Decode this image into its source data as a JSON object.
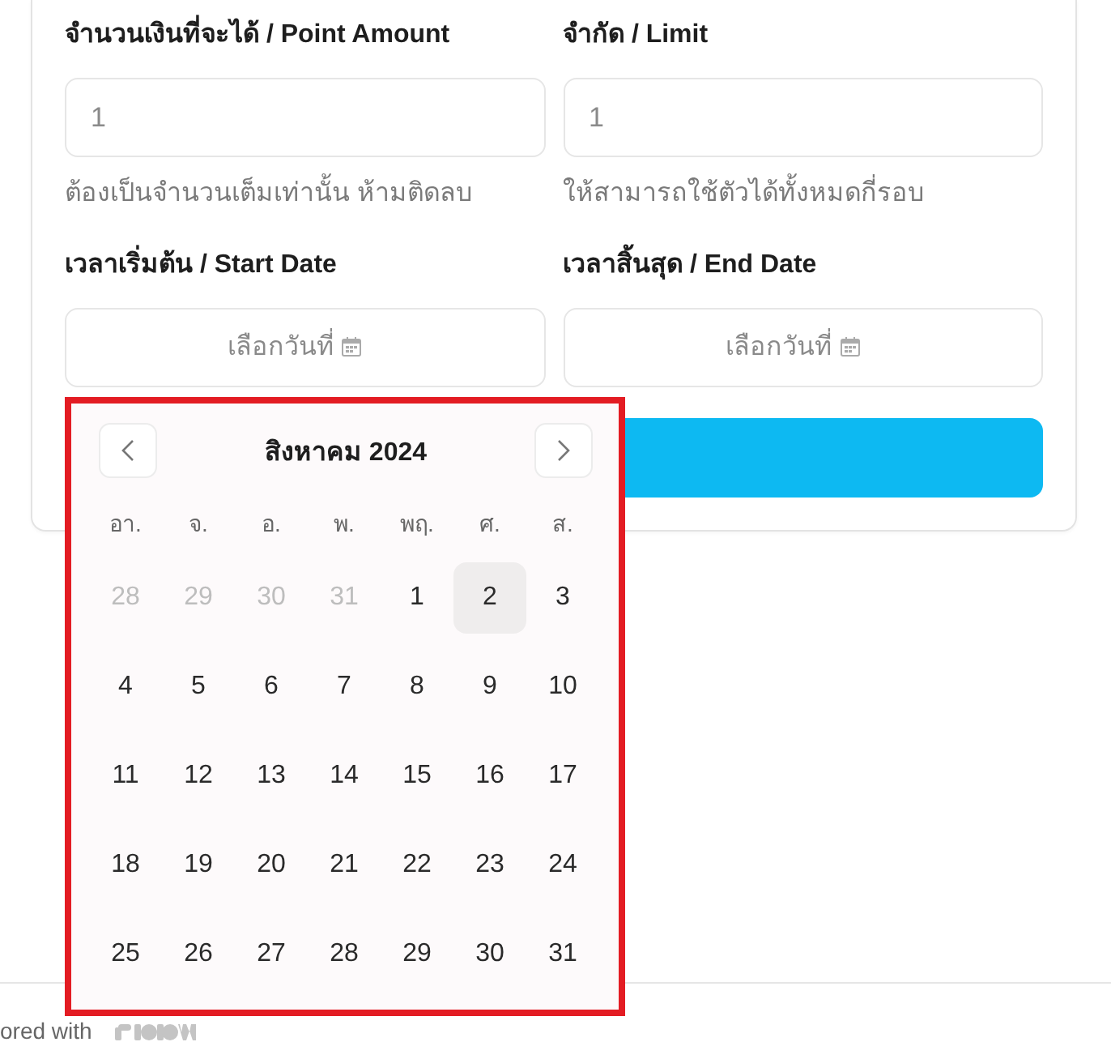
{
  "form": {
    "fields": [
      {
        "kind": "number",
        "label": "จำนวนเงินที่จะได้ / Point Amount",
        "placeholder": "1",
        "hint": "ต้องเป็นจำนวนเต็มเท่านั้น ห้ามติดลบ"
      },
      {
        "kind": "number",
        "label": "จำกัด / Limit",
        "placeholder": "1",
        "hint": "ให้สามารถใช้ตัวได้ทั้งหมดกี่รอบ"
      },
      {
        "kind": "date",
        "label": "เวลาเริ่มต้น / Start Date",
        "placeholder": "เลือกวันที่"
      },
      {
        "kind": "date",
        "label": "เวลาสิ้นสุด / End Date",
        "placeholder": "เลือกวันที่"
      }
    ]
  },
  "calendar": {
    "title": "สิงหาคม 2024",
    "weekdays": [
      "อา.",
      "จ.",
      "อ.",
      "พ.",
      "พฤ.",
      "ศ.",
      "ส."
    ],
    "weeks": [
      [
        {
          "day": "28",
          "outside_month": true,
          "selected": false
        },
        {
          "day": "29",
          "outside_month": true,
          "selected": false
        },
        {
          "day": "30",
          "outside_month": true,
          "selected": false
        },
        {
          "day": "31",
          "outside_month": true,
          "selected": false
        },
        {
          "day": "1",
          "outside_month": false,
          "selected": false
        },
        {
          "day": "2",
          "outside_month": false,
          "selected": true
        },
        {
          "day": "3",
          "outside_month": false,
          "selected": false
        }
      ],
      [
        {
          "day": "4",
          "outside_month": false,
          "selected": false
        },
        {
          "day": "5",
          "outside_month": false,
          "selected": false
        },
        {
          "day": "6",
          "outside_month": false,
          "selected": false
        },
        {
          "day": "7",
          "outside_month": false,
          "selected": false
        },
        {
          "day": "8",
          "outside_month": false,
          "selected": false
        },
        {
          "day": "9",
          "outside_month": false,
          "selected": false
        },
        {
          "day": "10",
          "outside_month": false,
          "selected": false
        }
      ],
      [
        {
          "day": "11",
          "outside_month": false,
          "selected": false
        },
        {
          "day": "12",
          "outside_month": false,
          "selected": false
        },
        {
          "day": "13",
          "outside_month": false,
          "selected": false
        },
        {
          "day": "14",
          "outside_month": false,
          "selected": false
        },
        {
          "day": "15",
          "outside_month": false,
          "selected": false
        },
        {
          "day": "16",
          "outside_month": false,
          "selected": false
        },
        {
          "day": "17",
          "outside_month": false,
          "selected": false
        }
      ],
      [
        {
          "day": "18",
          "outside_month": false,
          "selected": false
        },
        {
          "day": "19",
          "outside_month": false,
          "selected": false
        },
        {
          "day": "20",
          "outside_month": false,
          "selected": false
        },
        {
          "day": "21",
          "outside_month": false,
          "selected": false
        },
        {
          "day": "22",
          "outside_month": false,
          "selected": false
        },
        {
          "day": "23",
          "outside_month": false,
          "selected": false
        },
        {
          "day": "24",
          "outside_month": false,
          "selected": false
        }
      ],
      [
        {
          "day": "25",
          "outside_month": false,
          "selected": false
        },
        {
          "day": "26",
          "outside_month": false,
          "selected": false
        },
        {
          "day": "27",
          "outside_month": false,
          "selected": false
        },
        {
          "day": "28",
          "outside_month": false,
          "selected": false
        },
        {
          "day": "29",
          "outside_month": false,
          "selected": false
        },
        {
          "day": "30",
          "outside_month": false,
          "selected": false
        },
        {
          "day": "31",
          "outside_month": false,
          "selected": false
        }
      ]
    ]
  },
  "footer": {
    "text": "ored with"
  }
}
